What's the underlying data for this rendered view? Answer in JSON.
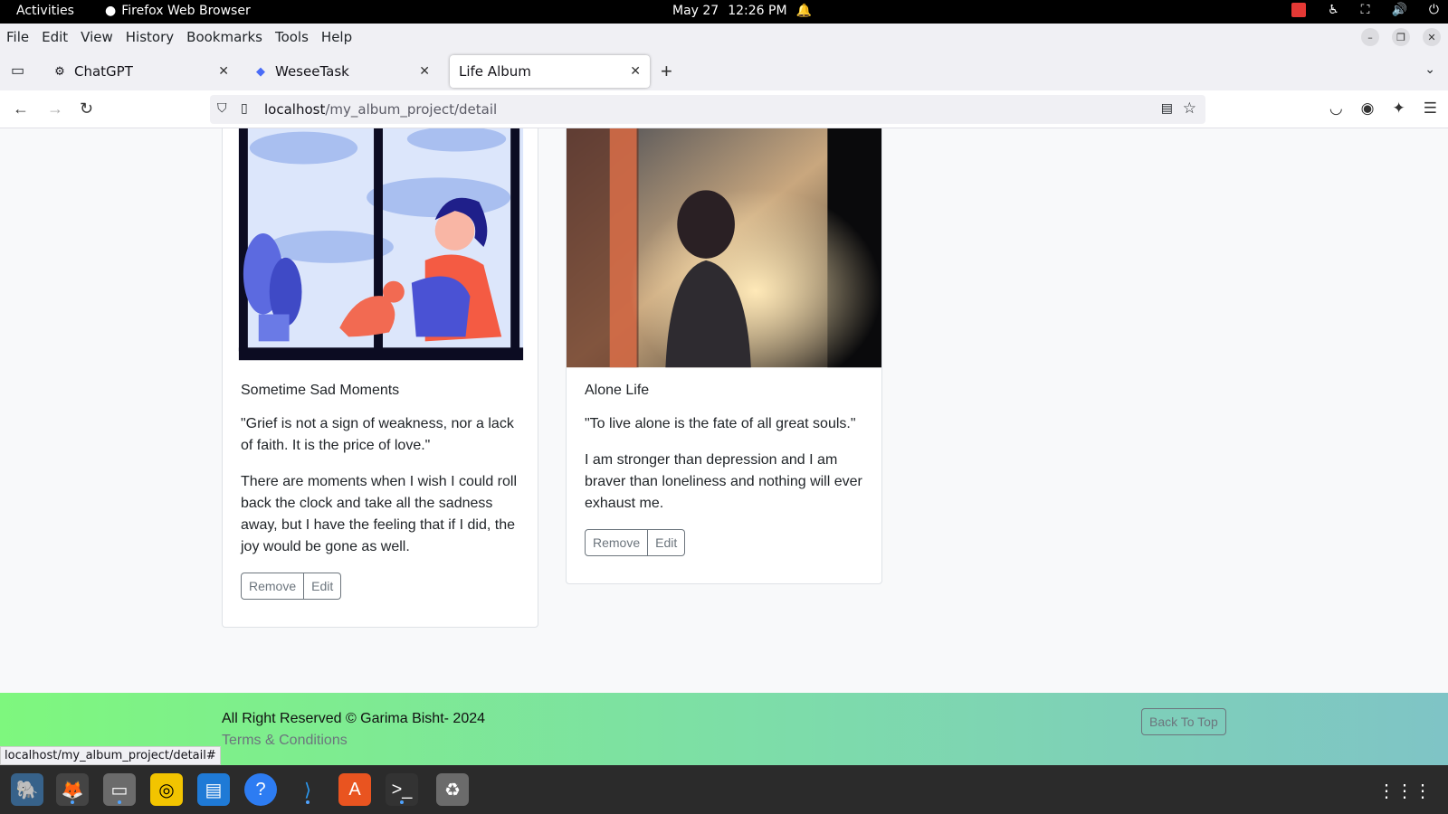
{
  "system": {
    "activities": "Activities",
    "app_name": "Firefox Web Browser",
    "date": "May 27",
    "time": "12:26 PM"
  },
  "menubar": {
    "items": [
      "File",
      "Edit",
      "View",
      "History",
      "Bookmarks",
      "Tools",
      "Help"
    ]
  },
  "tabs": [
    {
      "label": "ChatGPT"
    },
    {
      "label": "WeseeTask"
    },
    {
      "label": "Life Album"
    }
  ],
  "url": {
    "host": "localhost",
    "path": "/my_album_project/detail"
  },
  "cards": [
    {
      "title": "Sometime Sad Moments",
      "quote": "\"Grief is not a sign of weakness, nor a lack of faith. It is the price of love.\"",
      "text": "There are moments when I wish I could roll back the clock and take all the sadness away, but I have the feeling that if I did, the joy would be gone as well.",
      "remove_label": "Remove",
      "edit_label": "Edit"
    },
    {
      "title": "Alone Life",
      "quote": "\"To live alone is the fate of all great souls.\"",
      "text": "I am stronger than depression and I am braver than loneliness and nothing will ever exhaust me.",
      "remove_label": "Remove",
      "edit_label": "Edit"
    }
  ],
  "footer": {
    "copyright": "All Right Reserved © Garima Bisht- 2024",
    "terms": "Terms & Conditions",
    "back_to_top": "Back To Top"
  },
  "status_url": "localhost/my_album_project/detail#",
  "dock": [
    "pgadmin-icon",
    "firefox-icon",
    "files-icon",
    "rhythmbox-icon",
    "writer-icon",
    "help-icon",
    "vscode-icon",
    "app-center-icon",
    "terminal-icon",
    "trash-icon"
  ]
}
